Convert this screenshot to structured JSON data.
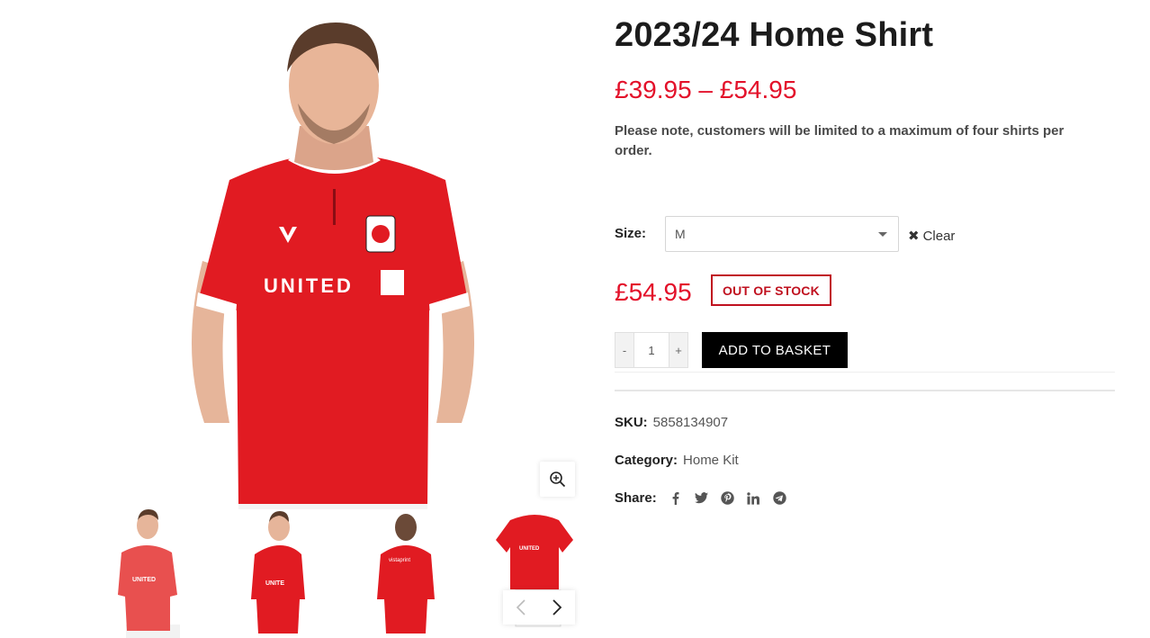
{
  "product": {
    "title": "2023/24 Home Shirt",
    "price_range": "£39.95 – £54.95",
    "note": "Please note, customers will be limited to a maximum of four shirts per order.",
    "size_label": "Size:",
    "size_selected": "M",
    "clear_label": "Clear",
    "clear_icon": "✖",
    "variant_price": "£54.95",
    "stock_status": "OUT OF STOCK",
    "quantity": "1",
    "qty_minus": "-",
    "qty_plus": "+",
    "add_to_basket_label": "ADD TO BASKET",
    "sku_label": "SKU:",
    "sku_value": "5858134907",
    "category_label": "Category:",
    "category_value": "Home Kit",
    "share_label": "Share:"
  },
  "share_icons": [
    "facebook-icon",
    "twitter-icon",
    "pinterest-icon",
    "linkedin-icon",
    "telegram-icon"
  ],
  "gallery": {
    "shirt_sponsor_text": "UNITED",
    "thumb_sponsor_text": "UNITED",
    "thumb_back_sponsor_text": "vistaprint"
  },
  "colors": {
    "accent_red": "#e3112a",
    "stock_red": "#c0101f",
    "button_black": "#000000",
    "shirt_red": "#e11b22"
  }
}
